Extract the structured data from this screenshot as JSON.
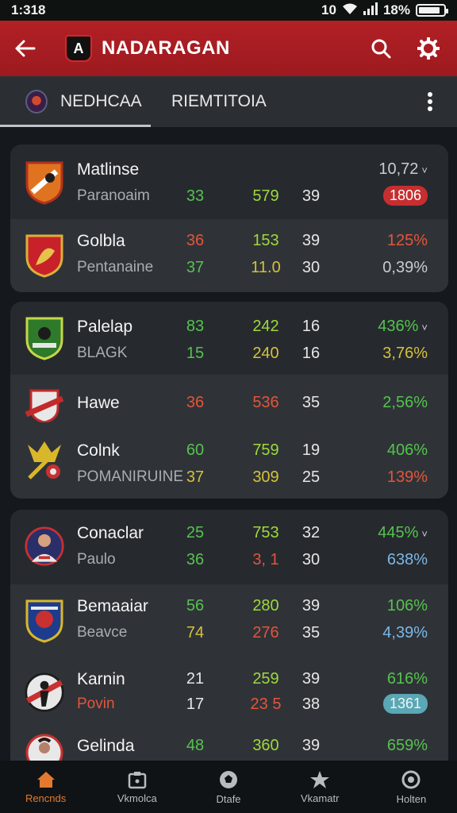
{
  "status_bar": {
    "time": "1:318",
    "icons_text": "10",
    "battery_text": "18%",
    "battery_level": 0.85
  },
  "app_bar": {
    "title": "NADARAGAN",
    "logo_glyph": "A"
  },
  "tabs": [
    {
      "label": "NEDHCAA"
    },
    {
      "label": "RIEMTITOIA"
    }
  ],
  "colors": {
    "accent": "#b22025",
    "background": "#15181c",
    "card": "#262a2f",
    "green": "#56c24e",
    "red": "#e2553b",
    "nav_active": "#e47a2e"
  },
  "cards": [
    {
      "rows": [
        {
          "name": "Matlinse",
          "sub": "Paranoaim",
          "c1": "33",
          "c2": "579",
          "c3": "39",
          "c4": "10,72",
          "c4_caret": "˅",
          "c4b": "1806",
          "logo": "crest-orange"
        },
        {
          "name": "Golbla",
          "sub": "Pentanaine",
          "c1": "36",
          "c1b": "37",
          "c2": "153",
          "c2b": "11.0",
          "c3": "39",
          "c3b": "30",
          "c4": "125%",
          "c4b": "0,39%",
          "logo": "crest-red"
        }
      ]
    },
    {
      "rows": [
        {
          "name": "Palelap",
          "sub": "BLAGK",
          "c1": "83",
          "c1b": "15",
          "c2": "242",
          "c2b": "240",
          "c3": "16",
          "c3b": "16",
          "c4": "436%",
          "c4_caret": "˅",
          "c4b": "3,76%",
          "logo": "crest-green"
        },
        {
          "name": "Hawe",
          "c1": "36",
          "c2": "536",
          "c3": "35",
          "c4": "2,56%",
          "logo": "crest-white-red"
        },
        {
          "name": "Colnk",
          "sub": "POMANIRUINE",
          "c1": "60",
          "c1b": "37",
          "c2": "759",
          "c2b": "309",
          "c3": "19",
          "c3b": "25",
          "c4": "406%",
          "c4b": "139%",
          "logo": "crest-yellow"
        }
      ]
    },
    {
      "rows": [
        {
          "name": "Conaclar",
          "sub": "Paulo",
          "c1": "25",
          "c1b": "36",
          "c2": "753",
          "c2b": "3, 1",
          "c3": "32",
          "c3b": "30",
          "c4": "445%",
          "c4_caret": "˅",
          "c4b": "638%",
          "logo": "avatar-player"
        },
        {
          "name": "Bemaaiar",
          "sub": "Beavce",
          "c1": "56",
          "c1b": "74",
          "c2": "280",
          "c2b": "276",
          "c3": "39",
          "c3b": "35",
          "c4": "106%",
          "c4b": "4,39%",
          "logo": "crest-blue"
        },
        {
          "name": "Karnin",
          "sub": "Povin",
          "c1": "21",
          "c1b": "17",
          "c2": "259",
          "c2b": "23 5",
          "c3": "39",
          "c3b": "38",
          "c4": "616%",
          "c4b": "1361",
          "logo": "crest-athlete"
        },
        {
          "name": "Gelinda",
          "c1": "48",
          "c2": "360",
          "c3": "39",
          "c4": "659%",
          "logo": "avatar-player-2"
        }
      ]
    }
  ],
  "bottom_nav": [
    {
      "label": "Rencnds",
      "icon": "home-icon",
      "active": true
    },
    {
      "label": "Vkmolca",
      "icon": "folder-icon",
      "active": false
    },
    {
      "label": "Dtafe",
      "icon": "ball-icon",
      "active": false
    },
    {
      "label": "Vkamatr",
      "icon": "star-icon",
      "active": false
    },
    {
      "label": "Holten",
      "icon": "settings-circle-icon",
      "active": false
    }
  ]
}
